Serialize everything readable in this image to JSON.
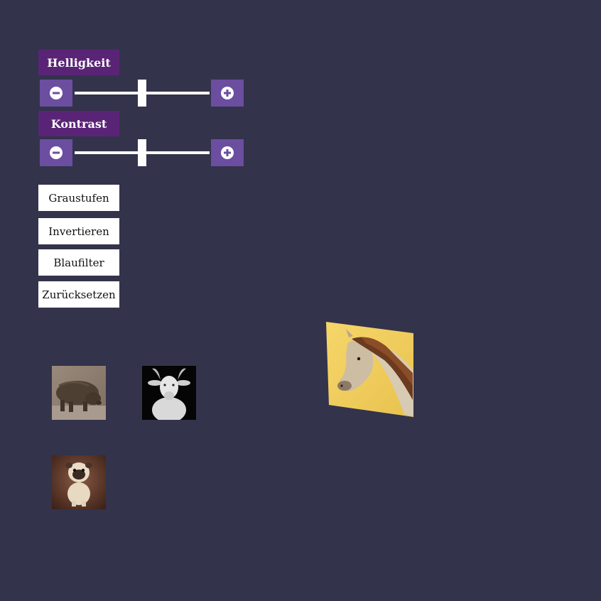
{
  "brightness": {
    "label": "Helligkeit",
    "minus_icon": "minus-circle-icon",
    "plus_icon": "plus-circle-icon",
    "value": 0.5
  },
  "contrast": {
    "label": "Kontrast",
    "minus_icon": "minus-circle-icon",
    "plus_icon": "plus-circle-icon",
    "value": 0.5
  },
  "filters": {
    "grayscale": "Graustufen",
    "invert": "Invertieren",
    "blue": "Blaufilter",
    "reset": "Zurücksetzen"
  },
  "gallery": {
    "items": [
      "boar",
      "goat",
      "pug"
    ]
  },
  "stage": {
    "image": "horse"
  },
  "colors": {
    "background": "#33334b",
    "label_bg": "#5a2476",
    "button_bg": "#6b4ea0",
    "filter_bg": "#ffffff"
  }
}
